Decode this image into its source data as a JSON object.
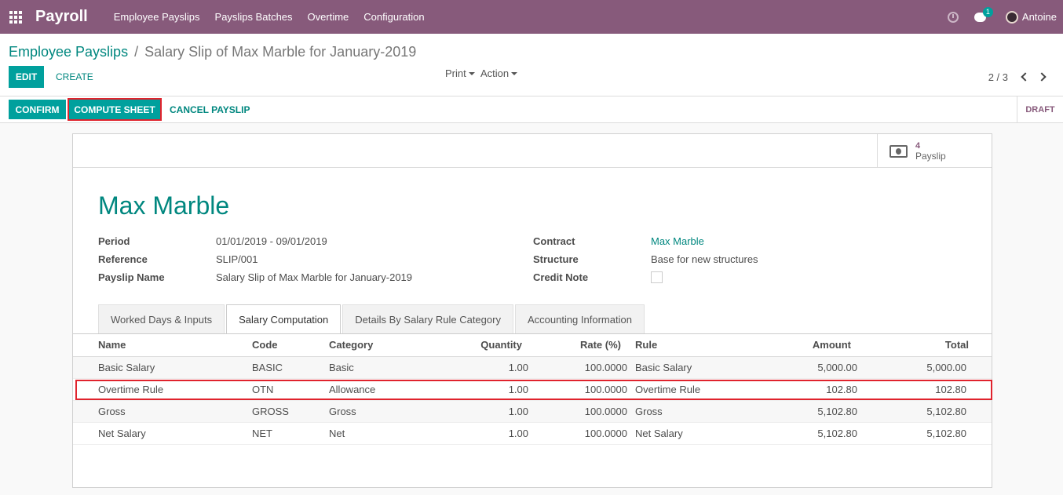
{
  "navbar": {
    "brand": "Payroll",
    "menu": [
      "Employee Payslips",
      "Payslips Batches",
      "Overtime",
      "Configuration"
    ],
    "chat_badge": "1",
    "user": "Antoine"
  },
  "breadcrumb": {
    "parent": "Employee Payslips",
    "separator": "/",
    "current": "Salary Slip of Max Marble for January-2019"
  },
  "actions": {
    "edit": "EDIT",
    "create": "CREATE",
    "print": "Print",
    "action": "Action"
  },
  "pager": {
    "text": "2 / 3"
  },
  "statusbar": {
    "confirm": "CONFIRM",
    "compute": "COMPUTE SHEET",
    "cancel": "CANCEL PAYSLIP",
    "status": "DRAFT"
  },
  "smart_button": {
    "count": "4",
    "label": "Payslip"
  },
  "employee": {
    "name": "Max Marble"
  },
  "fields": {
    "period_label": "Period",
    "period_value": "01/01/2019 - 09/01/2019",
    "reference_label": "Reference",
    "reference_value": "SLIP/001",
    "payslip_name_label": "Payslip Name",
    "payslip_name_value": "Salary Slip of Max Marble for January-2019",
    "contract_label": "Contract",
    "contract_value": "Max Marble",
    "structure_label": "Structure",
    "structure_value": "Base for new structures",
    "credit_note_label": "Credit Note"
  },
  "tabs": [
    "Worked Days & Inputs",
    "Salary Computation",
    "Details By Salary Rule Category",
    "Accounting Information"
  ],
  "active_tab": "Salary Computation",
  "table": {
    "headers": [
      "Name",
      "Code",
      "Category",
      "Quantity",
      "Rate (%)",
      "Rule",
      "Amount",
      "Total"
    ],
    "rows": [
      [
        "Basic Salary",
        "BASIC",
        "Basic",
        "1.00",
        "100.0000",
        "Basic Salary",
        "5,000.00",
        "5,000.00"
      ],
      [
        "Overtime Rule",
        "OTN",
        "Allowance",
        "1.00",
        "100.0000",
        "Overtime Rule",
        "102.80",
        "102.80"
      ],
      [
        "Gross",
        "GROSS",
        "Gross",
        "1.00",
        "100.0000",
        "Gross",
        "5,102.80",
        "5,102.80"
      ],
      [
        "Net Salary",
        "NET",
        "Net",
        "1.00",
        "100.0000",
        "Net Salary",
        "5,102.80",
        "5,102.80"
      ]
    ]
  },
  "colors": {
    "primary": "#875a7b",
    "accent": "#00a09d",
    "link": "#00877f",
    "highlight": "#e0232d"
  }
}
